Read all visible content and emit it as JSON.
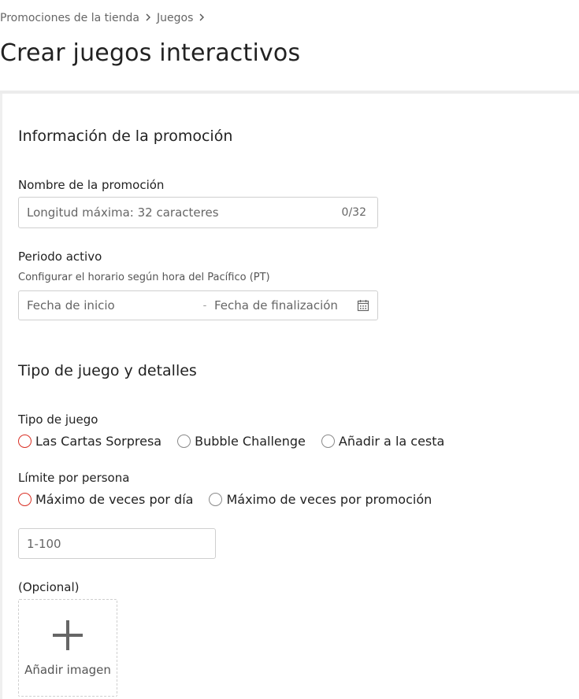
{
  "breadcrumb": {
    "items": [
      "Promociones de la tienda",
      "Juegos"
    ]
  },
  "page": {
    "title": "Crear juegos interactivos"
  },
  "promo_info": {
    "section_title": "Información de la promoción",
    "name_label": "Nombre de la promoción",
    "name_placeholder": "Longitud máxima: 32 caracteres",
    "name_counter": "0/32",
    "period_label": "Periodo activo",
    "period_help": "Configurar el horario según hora del Pacífico (PT)",
    "start_placeholder": "Fecha de inicio",
    "separator": "-",
    "end_placeholder": "Fecha de finalización"
  },
  "game": {
    "section_title": "Tipo de juego y detalles",
    "type_label": "Tipo de juego",
    "type_options": [
      "Las Cartas Sorpresa",
      "Bubble Challenge",
      "Añadir a la cesta"
    ],
    "limit_label": "Límite por persona",
    "limit_options": [
      "Máximo de veces por día",
      "Máximo de veces por promoción"
    ],
    "limit_placeholder": "1-100",
    "optional_label": "(Opcional)",
    "add_image_label": "Añadir imagen"
  },
  "icons": {
    "breadcrumb_separator": "chevron-right-icon",
    "date_picker": "calendar-icon",
    "upload": "plus-icon"
  },
  "colors": {
    "error_radio": "#d93025",
    "border": "#cfcfcf"
  }
}
